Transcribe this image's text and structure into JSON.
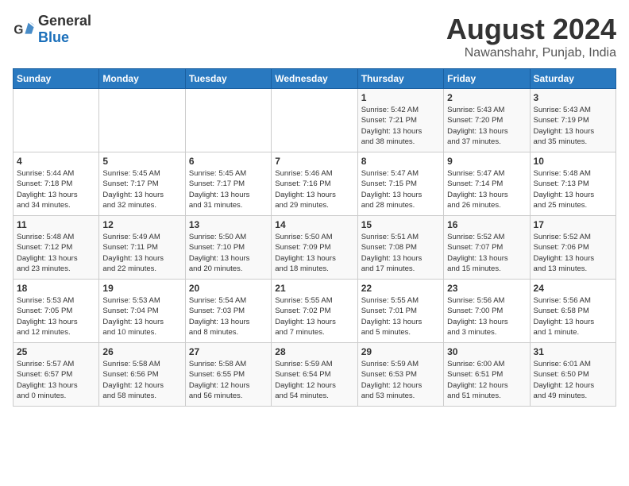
{
  "logo": {
    "text_general": "General",
    "text_blue": "Blue"
  },
  "title": "August 2024",
  "subtitle": "Nawanshahr, Punjab, India",
  "weekdays": [
    "Sunday",
    "Monday",
    "Tuesday",
    "Wednesday",
    "Thursday",
    "Friday",
    "Saturday"
  ],
  "weeks": [
    [
      {
        "day": "",
        "detail": ""
      },
      {
        "day": "",
        "detail": ""
      },
      {
        "day": "",
        "detail": ""
      },
      {
        "day": "",
        "detail": ""
      },
      {
        "day": "1",
        "detail": "Sunrise: 5:42 AM\nSunset: 7:21 PM\nDaylight: 13 hours\nand 38 minutes."
      },
      {
        "day": "2",
        "detail": "Sunrise: 5:43 AM\nSunset: 7:20 PM\nDaylight: 13 hours\nand 37 minutes."
      },
      {
        "day": "3",
        "detail": "Sunrise: 5:43 AM\nSunset: 7:19 PM\nDaylight: 13 hours\nand 35 minutes."
      }
    ],
    [
      {
        "day": "4",
        "detail": "Sunrise: 5:44 AM\nSunset: 7:18 PM\nDaylight: 13 hours\nand 34 minutes."
      },
      {
        "day": "5",
        "detail": "Sunrise: 5:45 AM\nSunset: 7:17 PM\nDaylight: 13 hours\nand 32 minutes."
      },
      {
        "day": "6",
        "detail": "Sunrise: 5:45 AM\nSunset: 7:17 PM\nDaylight: 13 hours\nand 31 minutes."
      },
      {
        "day": "7",
        "detail": "Sunrise: 5:46 AM\nSunset: 7:16 PM\nDaylight: 13 hours\nand 29 minutes."
      },
      {
        "day": "8",
        "detail": "Sunrise: 5:47 AM\nSunset: 7:15 PM\nDaylight: 13 hours\nand 28 minutes."
      },
      {
        "day": "9",
        "detail": "Sunrise: 5:47 AM\nSunset: 7:14 PM\nDaylight: 13 hours\nand 26 minutes."
      },
      {
        "day": "10",
        "detail": "Sunrise: 5:48 AM\nSunset: 7:13 PM\nDaylight: 13 hours\nand 25 minutes."
      }
    ],
    [
      {
        "day": "11",
        "detail": "Sunrise: 5:48 AM\nSunset: 7:12 PM\nDaylight: 13 hours\nand 23 minutes."
      },
      {
        "day": "12",
        "detail": "Sunrise: 5:49 AM\nSunset: 7:11 PM\nDaylight: 13 hours\nand 22 minutes."
      },
      {
        "day": "13",
        "detail": "Sunrise: 5:50 AM\nSunset: 7:10 PM\nDaylight: 13 hours\nand 20 minutes."
      },
      {
        "day": "14",
        "detail": "Sunrise: 5:50 AM\nSunset: 7:09 PM\nDaylight: 13 hours\nand 18 minutes."
      },
      {
        "day": "15",
        "detail": "Sunrise: 5:51 AM\nSunset: 7:08 PM\nDaylight: 13 hours\nand 17 minutes."
      },
      {
        "day": "16",
        "detail": "Sunrise: 5:52 AM\nSunset: 7:07 PM\nDaylight: 13 hours\nand 15 minutes."
      },
      {
        "day": "17",
        "detail": "Sunrise: 5:52 AM\nSunset: 7:06 PM\nDaylight: 13 hours\nand 13 minutes."
      }
    ],
    [
      {
        "day": "18",
        "detail": "Sunrise: 5:53 AM\nSunset: 7:05 PM\nDaylight: 13 hours\nand 12 minutes."
      },
      {
        "day": "19",
        "detail": "Sunrise: 5:53 AM\nSunset: 7:04 PM\nDaylight: 13 hours\nand 10 minutes."
      },
      {
        "day": "20",
        "detail": "Sunrise: 5:54 AM\nSunset: 7:03 PM\nDaylight: 13 hours\nand 8 minutes."
      },
      {
        "day": "21",
        "detail": "Sunrise: 5:55 AM\nSunset: 7:02 PM\nDaylight: 13 hours\nand 7 minutes."
      },
      {
        "day": "22",
        "detail": "Sunrise: 5:55 AM\nSunset: 7:01 PM\nDaylight: 13 hours\nand 5 minutes."
      },
      {
        "day": "23",
        "detail": "Sunrise: 5:56 AM\nSunset: 7:00 PM\nDaylight: 13 hours\nand 3 minutes."
      },
      {
        "day": "24",
        "detail": "Sunrise: 5:56 AM\nSunset: 6:58 PM\nDaylight: 13 hours\nand 1 minute."
      }
    ],
    [
      {
        "day": "25",
        "detail": "Sunrise: 5:57 AM\nSunset: 6:57 PM\nDaylight: 13 hours\nand 0 minutes."
      },
      {
        "day": "26",
        "detail": "Sunrise: 5:58 AM\nSunset: 6:56 PM\nDaylight: 12 hours\nand 58 minutes."
      },
      {
        "day": "27",
        "detail": "Sunrise: 5:58 AM\nSunset: 6:55 PM\nDaylight: 12 hours\nand 56 minutes."
      },
      {
        "day": "28",
        "detail": "Sunrise: 5:59 AM\nSunset: 6:54 PM\nDaylight: 12 hours\nand 54 minutes."
      },
      {
        "day": "29",
        "detail": "Sunrise: 5:59 AM\nSunset: 6:53 PM\nDaylight: 12 hours\nand 53 minutes."
      },
      {
        "day": "30",
        "detail": "Sunrise: 6:00 AM\nSunset: 6:51 PM\nDaylight: 12 hours\nand 51 minutes."
      },
      {
        "day": "31",
        "detail": "Sunrise: 6:01 AM\nSunset: 6:50 PM\nDaylight: 12 hours\nand 49 minutes."
      }
    ]
  ]
}
